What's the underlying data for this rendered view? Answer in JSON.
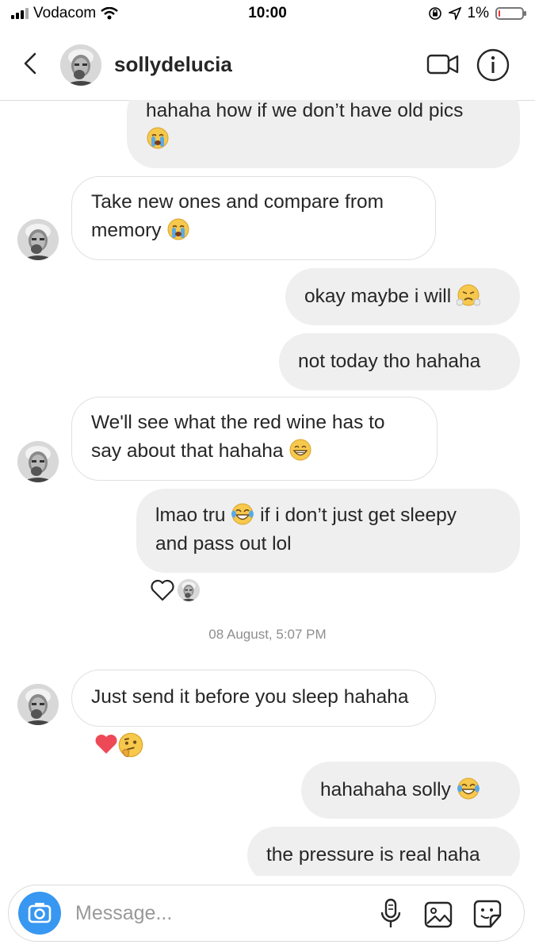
{
  "status_bar": {
    "carrier": "Vodacom",
    "time": "10:00",
    "battery": "1%",
    "battery_level": 0.01
  },
  "header": {
    "username": "sollydelucia",
    "back_icon": "chevron-left-icon",
    "video_icon": "video-camera-icon",
    "info_icon": "info-icon"
  },
  "messages": [
    {
      "side": "out",
      "line1": "hahaha how if we don’t have old pics",
      "emoji": "loudly-crying-face"
    },
    {
      "side": "in",
      "line1": "Take new ones and compare from",
      "line2": "memory",
      "emoji": "loudly-crying-face"
    },
    {
      "side": "out",
      "text": "okay maybe i will",
      "emoji": "face-with-steam"
    },
    {
      "side": "out",
      "text": "not today tho hahaha"
    },
    {
      "side": "in",
      "line1": "We'll see what the red wine has to",
      "line2": "say about that hahaha",
      "emoji": "grinning-face"
    },
    {
      "side": "out",
      "line1a": "lmao tru",
      "line1b": "if i don’t just get sleepy",
      "line2": "and pass out lol",
      "emoji": "tears-of-joy"
    },
    {
      "side": "in",
      "text": "Just send it before you sleep hahaha"
    },
    {
      "side": "out",
      "text": "hahahaha solly",
      "emoji": "tears-of-joy"
    },
    {
      "side": "out",
      "text": "the pressure is real haha"
    }
  ],
  "timestamp": "08 August, 5:07 PM",
  "reactions": {
    "like_icon": "heart-outline-icon",
    "reacted": [
      "red-heart",
      "thinking-face"
    ]
  },
  "composer": {
    "placeholder": "Message...",
    "camera_icon": "camera-icon",
    "mic_icon": "microphone-icon",
    "gallery_icon": "gallery-icon",
    "sticker_icon": "sticker-icon"
  },
  "colors": {
    "accent": "#3897f0",
    "outgoing_bubble": "#efefef",
    "incoming_border": "#e0e0e0",
    "text": "#262626",
    "meta": "#8e8e8e"
  }
}
